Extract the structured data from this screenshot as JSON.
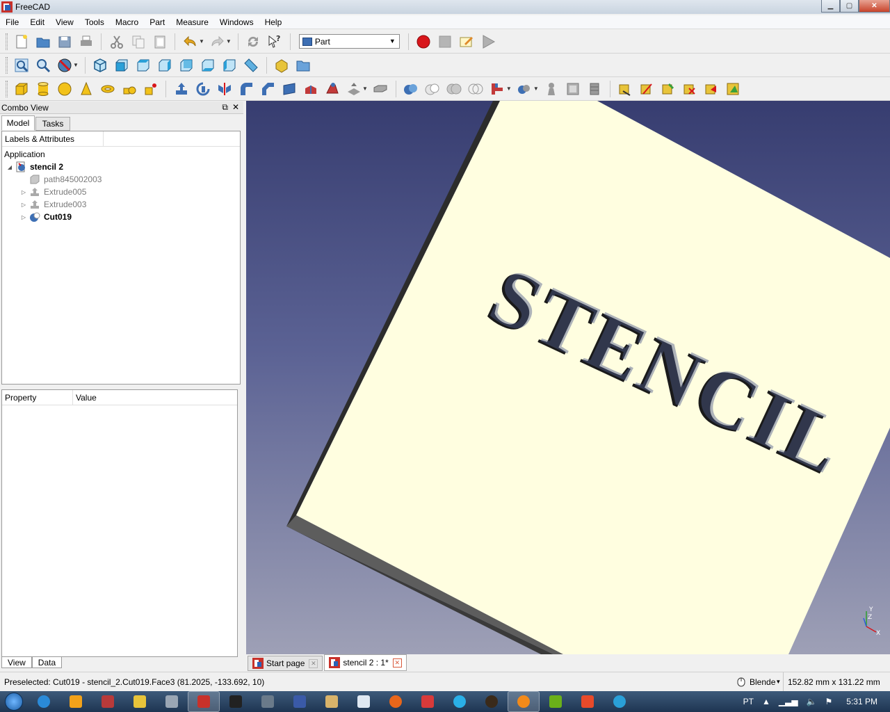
{
  "window": {
    "title": "FreeCAD",
    "controls": [
      "minimize",
      "maximize",
      "close"
    ]
  },
  "menu": [
    "File",
    "Edit",
    "View",
    "Tools",
    "Macro",
    "Part",
    "Measure",
    "Windows",
    "Help"
  ],
  "workbench": {
    "selected": "Part"
  },
  "combo_view": {
    "title": "Combo View",
    "tabs": [
      "Model",
      "Tasks"
    ],
    "tree_header": "Labels & Attributes",
    "root": "Application",
    "document": "stencil 2",
    "items": [
      "path845002003",
      "Extrude005",
      "Extrude003",
      "Cut019"
    ]
  },
  "property_panel": {
    "col_property": "Property",
    "col_value": "Value",
    "tabs": [
      "View",
      "Data"
    ]
  },
  "viewport": {
    "stencil_text": "STENCIL",
    "axes": [
      "Y",
      "Z",
      "X"
    ]
  },
  "doc_tabs": [
    "Start page",
    "stencil 2 : 1*"
  ],
  "status": {
    "message": "Preselected: Cut019 - stencil_2.Cut019.Face3 (81.2025, -133.692, 10)",
    "nav_style": "Blende",
    "dimensions": "152.82 mm x 131.22 mm"
  },
  "taskbar": {
    "lang": "PT",
    "time": "5:31 PM"
  },
  "colors": {
    "plate": "#fffee0",
    "bg_top": "#373d70",
    "bg_bottom": "#9ea0b6",
    "record": "#d8161b"
  }
}
